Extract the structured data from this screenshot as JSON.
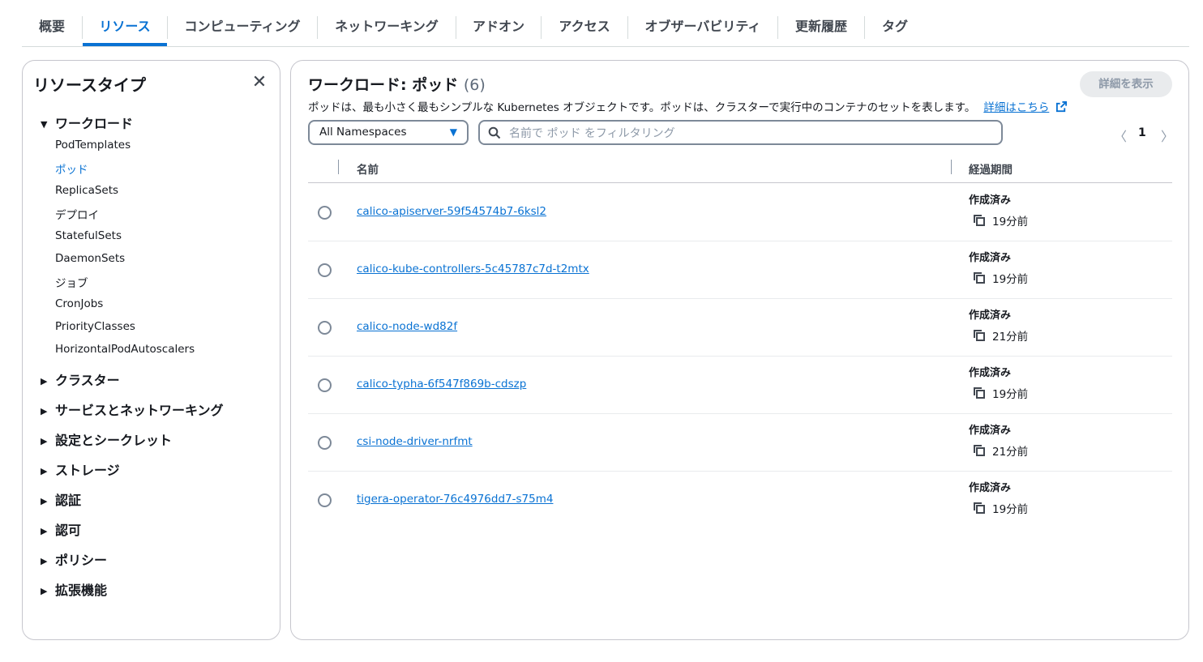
{
  "tabs": [
    {
      "label": "概要"
    },
    {
      "label": "リソース"
    },
    {
      "label": "コンピューティング"
    },
    {
      "label": "ネットワーキング"
    },
    {
      "label": "アドオン"
    },
    {
      "label": "アクセス"
    },
    {
      "label": "オブザーバビリティ"
    },
    {
      "label": "更新履歴"
    },
    {
      "label": "タグ"
    }
  ],
  "active_tab": "リソース",
  "sidebar": {
    "title": "リソースタイプ",
    "close_icon": "close-icon",
    "workload": {
      "label": "ワークロード",
      "expanded": true,
      "items": [
        {
          "label": "PodTemplates"
        },
        {
          "label": "ポッド"
        },
        {
          "label": "ReplicaSets"
        },
        {
          "label": "デプロイ"
        },
        {
          "label": "StatefulSets"
        },
        {
          "label": "DaemonSets"
        },
        {
          "label": "ジョブ"
        },
        {
          "label": "CronJobs"
        },
        {
          "label": "PriorityClasses"
        },
        {
          "label": "HorizontalPodAutoscalers"
        }
      ],
      "selected": "ポッド"
    },
    "sections": [
      {
        "label": "クラスター"
      },
      {
        "label": "サービスとネットワーキング"
      },
      {
        "label": "設定とシークレット"
      },
      {
        "label": "ストレージ"
      },
      {
        "label": "認証"
      },
      {
        "label": "認可"
      },
      {
        "label": "ポリシー"
      },
      {
        "label": "拡張機能"
      }
    ]
  },
  "main": {
    "title": "ワークロード: ポッド",
    "count": "(6)",
    "detail_button": "詳細を表示",
    "description": "ポッドは、最も小さく最もシンプルな Kubernetes オブジェクトです。ポッドは、クラスターで実行中のコンテナのセットを表します。",
    "learn_more": "詳細はこちら",
    "namespace_select": "All Namespaces",
    "search_placeholder": "名前で ポッド をフィルタリング",
    "page": "1",
    "columns": {
      "name": "名前",
      "age": "経過期間"
    },
    "rows": [
      {
        "name": "calico-apiserver-59f54574b7-6ksl2",
        "age_label": "作成済み",
        "age": "19分前"
      },
      {
        "name": "calico-kube-controllers-5c45787c7d-t2mtx",
        "age_label": "作成済み",
        "age": "19分前"
      },
      {
        "name": "calico-node-wd82f",
        "age_label": "作成済み",
        "age": "21分前"
      },
      {
        "name": "calico-typha-6f547f869b-cdszp",
        "age_label": "作成済み",
        "age": "19分前"
      },
      {
        "name": "csi-node-driver-nrfmt",
        "age_label": "作成済み",
        "age": "21分前"
      },
      {
        "name": "tigera-operator-76c4976dd7-s75m4",
        "age_label": "作成済み",
        "age": "19分前"
      }
    ]
  },
  "colors": {
    "accent": "#0972d3",
    "text": "#16191f",
    "muted": "#8d99a8",
    "border": "#c6c6cd"
  }
}
